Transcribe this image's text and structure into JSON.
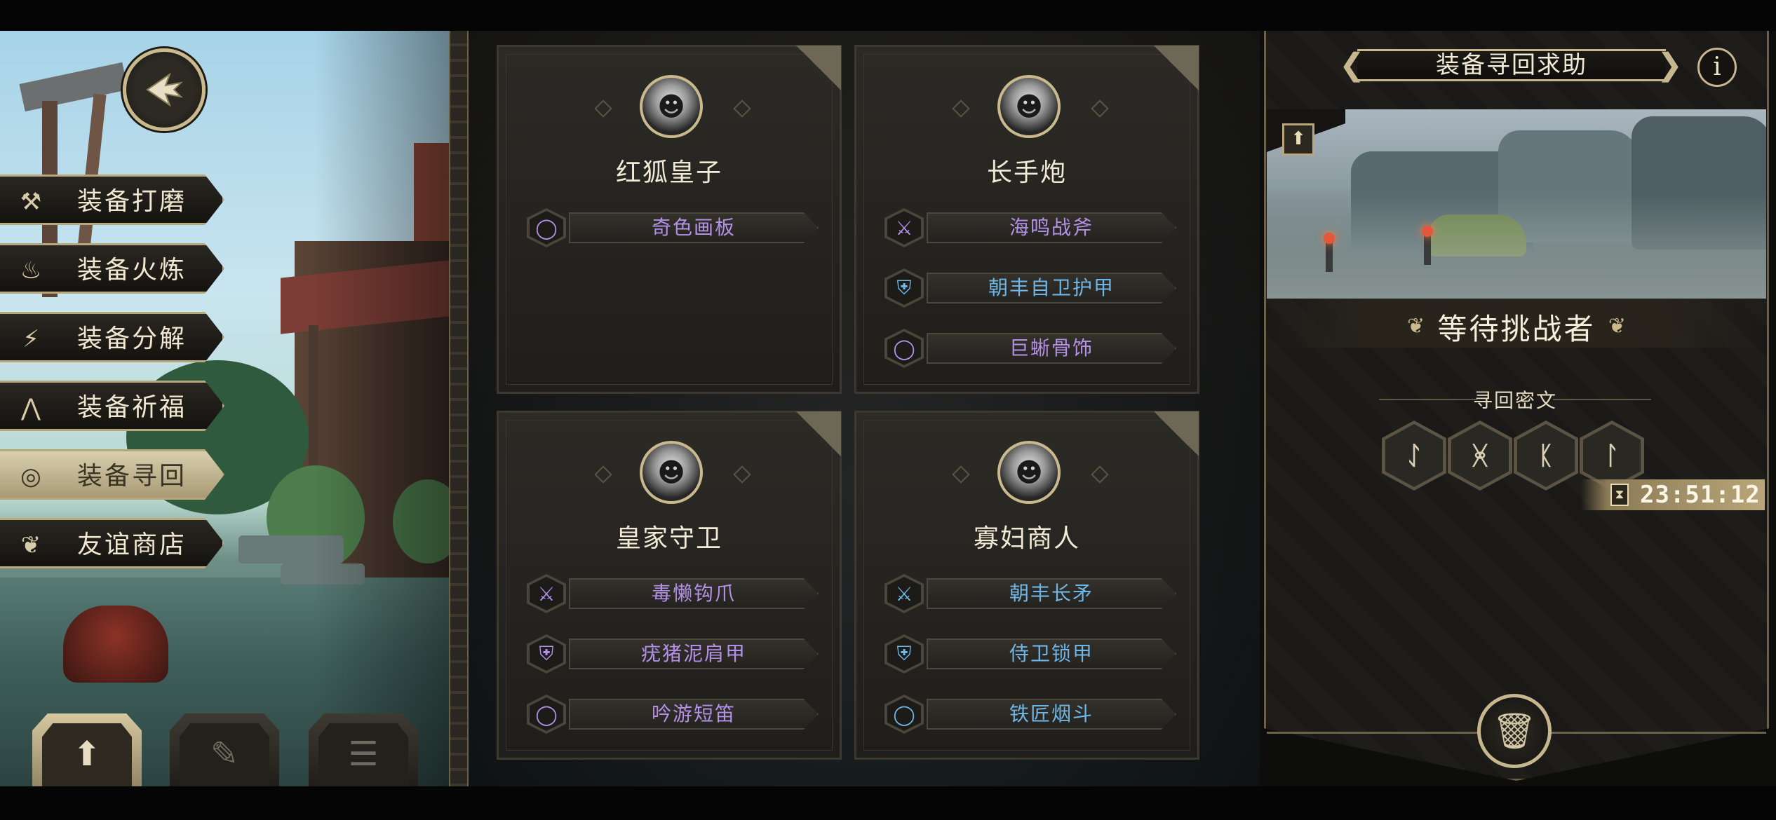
{
  "menu": {
    "items": [
      {
        "label": "装备打磨",
        "icon": "hammer-icon",
        "glyph": "⚒",
        "active": false
      },
      {
        "label": "装备火炼",
        "icon": "flame-icon",
        "glyph": "♨",
        "active": false
      },
      {
        "label": "装备分解",
        "icon": "break-icon",
        "glyph": "⚡",
        "active": false
      },
      {
        "label": "装备祈福",
        "icon": "pray-icon",
        "glyph": "⋀",
        "active": false
      },
      {
        "label": "装备寻回",
        "icon": "target-icon",
        "glyph": "◎",
        "active": true
      },
      {
        "label": "友谊商店",
        "icon": "fox-icon",
        "glyph": "❦",
        "active": false
      }
    ]
  },
  "cards": [
    {
      "name": "红狐皇子",
      "items": [
        {
          "label": "奇色画板",
          "slot": "ring",
          "color": "#b491e8"
        }
      ]
    },
    {
      "name": "长手炮",
      "items": [
        {
          "label": "海鸣战斧",
          "slot": "weapon",
          "color": "#b491e8"
        },
        {
          "label": "朝丰自卫护甲",
          "slot": "armor",
          "color": "#6fb6e6"
        },
        {
          "label": "巨蜥骨饰",
          "slot": "ring",
          "color": "#b491e8"
        }
      ]
    },
    {
      "name": "皇家守卫",
      "items": [
        {
          "label": "毒懒钩爪",
          "slot": "weapon",
          "color": "#b491e8"
        },
        {
          "label": "疣猪泥肩甲",
          "slot": "armor",
          "color": "#b491e8"
        },
        {
          "label": "吟游短笛",
          "slot": "ring",
          "color": "#b491e8"
        }
      ]
    },
    {
      "name": "寡妇商人",
      "items": [
        {
          "label": "朝丰长矛",
          "slot": "weapon",
          "color": "#6fb6e6"
        },
        {
          "label": "侍卫锁甲",
          "slot": "armor",
          "color": "#6fb6e6"
        },
        {
          "label": "铁匠烟斗",
          "slot": "ring",
          "color": "#6fb6e6"
        }
      ]
    }
  ],
  "panel": {
    "title": "装备寻回求助",
    "info_label": "i",
    "status": "等待挑战者",
    "cipher_label": "寻回密文",
    "runes": [
      "ᛇ",
      "ᚸ",
      "ᛕ",
      "ᛚ"
    ],
    "timer": "23:51:12"
  },
  "colors": {
    "gold": "#c6b78e",
    "epic": "#b491e8",
    "rare": "#6fb6e6"
  }
}
